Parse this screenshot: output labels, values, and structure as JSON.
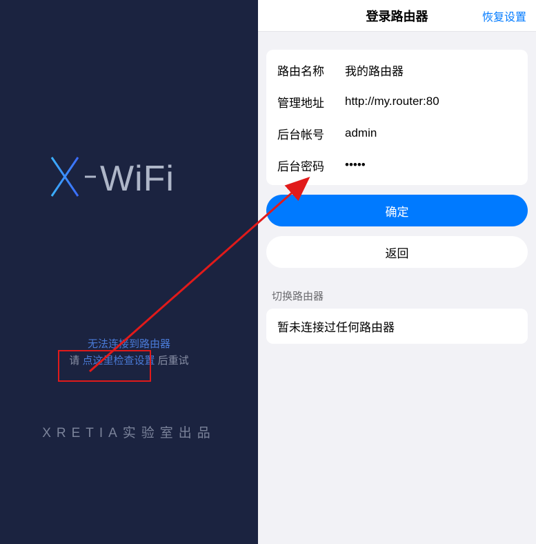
{
  "left": {
    "logo_text": "X-WiFi",
    "error_line1": "无法连接到路由器",
    "error_prefix": "请 ",
    "error_link": "点这里检查设置",
    "error_suffix": " 后重试",
    "footer": "XRETIA实验室出品"
  },
  "right": {
    "nav": {
      "title": "登录路由器",
      "restore": "恢复设置"
    },
    "fields": {
      "name": {
        "label": "路由名称",
        "value": "我的路由器"
      },
      "url": {
        "label": "管理地址",
        "value": "http://my.router:80"
      },
      "user": {
        "label": "后台帐号",
        "value": "admin"
      },
      "pass": {
        "label": "后台密码",
        "value": "•••••"
      }
    },
    "confirm": "确定",
    "back": "返回",
    "switch_section": "切换路由器",
    "empty_history": "暂未连接过任何路由器"
  },
  "colors": {
    "accent": "#007aff",
    "dark_bg": "#1b2340",
    "arrow": "#e11a1a"
  }
}
